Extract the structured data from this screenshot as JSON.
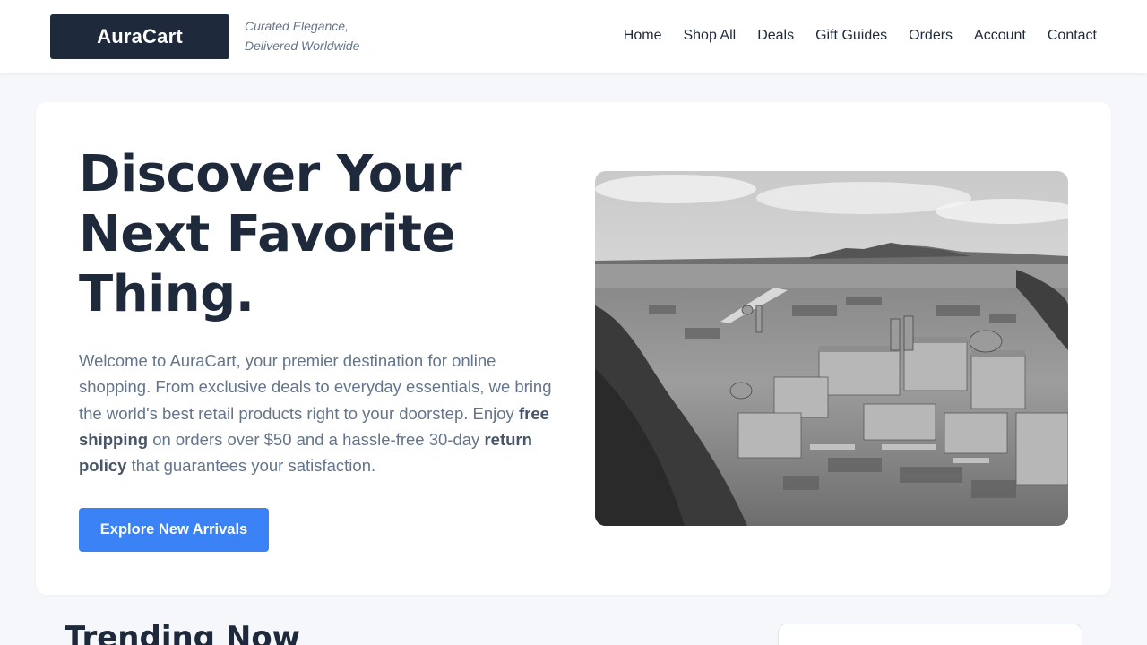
{
  "brand": {
    "name": "AuraCart",
    "tagline_line1": "Curated Elegance,",
    "tagline_line2": "Delivered Worldwide"
  },
  "nav": {
    "items": [
      {
        "label": "Home"
      },
      {
        "label": "Shop All"
      },
      {
        "label": "Deals"
      },
      {
        "label": "Gift Guides"
      },
      {
        "label": "Orders"
      },
      {
        "label": "Account"
      },
      {
        "label": "Contact"
      }
    ]
  },
  "hero": {
    "title_line1": "Discover Your",
    "title_line2": "Next Favorite",
    "title_line3": "Thing.",
    "text_part1": "Welcome to AuraCart, your premier destination for online shopping. From exclusive deals to everyday essentials, we bring the world's best retail products right to your doorstep. Enjoy ",
    "text_bold1": "free shipping",
    "text_part2": " on orders over $50 and a hassle-free 30-day ",
    "text_bold2": "return policy",
    "text_part3": " that guarantees your satisfaction.",
    "cta_label": "Explore New Arrivals"
  },
  "trending": {
    "title": "Trending Now"
  },
  "colors": {
    "primary_dark": "#1e293b",
    "accent": "#3b82f6",
    "muted_text": "#64748b",
    "page_bg": "#f5f7fa"
  }
}
